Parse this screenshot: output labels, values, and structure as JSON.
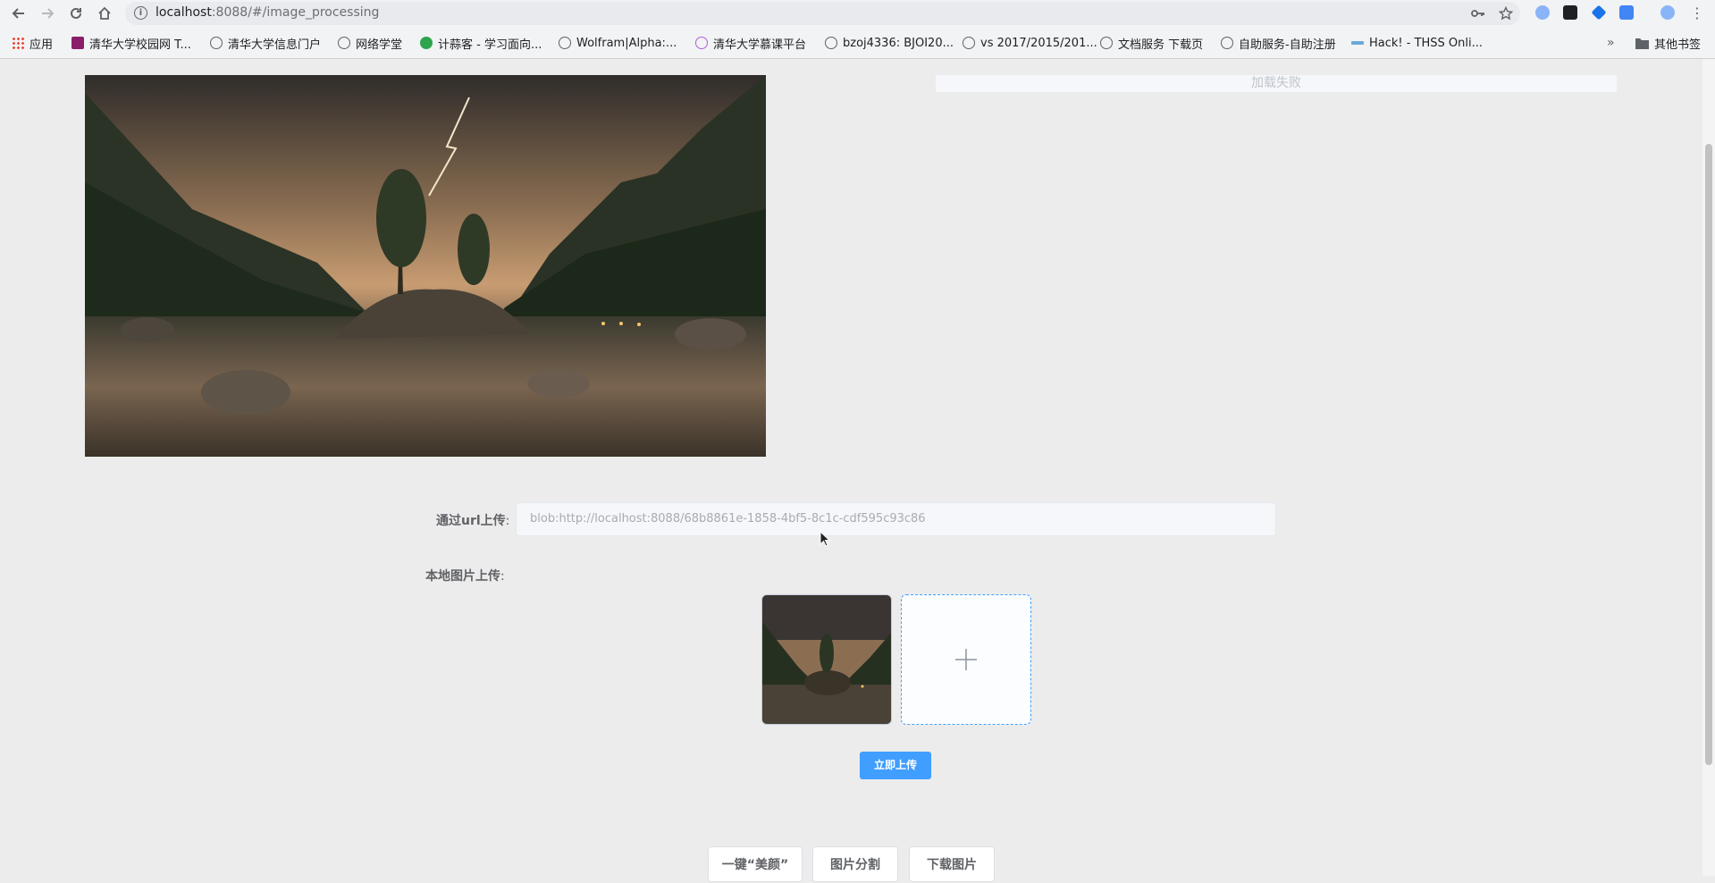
{
  "browser": {
    "url_host": "localhost",
    "url_rest": ":8088/#/image_processing",
    "bookmarks": [
      {
        "label": "应用",
        "icon": "apps-grid-icon"
      },
      {
        "label": "清华大学校园网 T...",
        "icon": "tsinghua-icon"
      },
      {
        "label": "清华大学信息门户",
        "icon": "globe-icon"
      },
      {
        "label": "网络学堂",
        "icon": "globe-icon"
      },
      {
        "label": "计蒜客 - 学习面向...",
        "icon": "jisuanke-icon"
      },
      {
        "label": "Wolfram|Alpha:...",
        "icon": "globe-icon"
      },
      {
        "label": "清华大学慕课平台",
        "icon": "xuetangx-icon"
      },
      {
        "label": "bzoj4336: BJOI20...",
        "icon": "globe-icon"
      },
      {
        "label": "vs 2017/2015/201...",
        "icon": "globe-icon"
      },
      {
        "label": "文档服务 下载页",
        "icon": "globe-icon"
      },
      {
        "label": "自助服务-自助注册",
        "icon": "globe-icon"
      },
      {
        "label": "Hack! - THSS Onli...",
        "icon": "hack-icon"
      }
    ],
    "other_bookmarks": "其他书签"
  },
  "page": {
    "result_status": "加载失败",
    "url_upload_label": "通过url上传",
    "url_upload_value": "blob:http://localhost:8088/68b8861e-1858-4bf5-8c1c-cdf595c93c86",
    "local_upload_label": "本地图片上传",
    "upload_now": "立即上传",
    "actions": [
      "一键“美颜”",
      "图片分割",
      "下载图片"
    ]
  },
  "colors": {
    "primary": "#409eff",
    "page_bg": "#ececec"
  }
}
